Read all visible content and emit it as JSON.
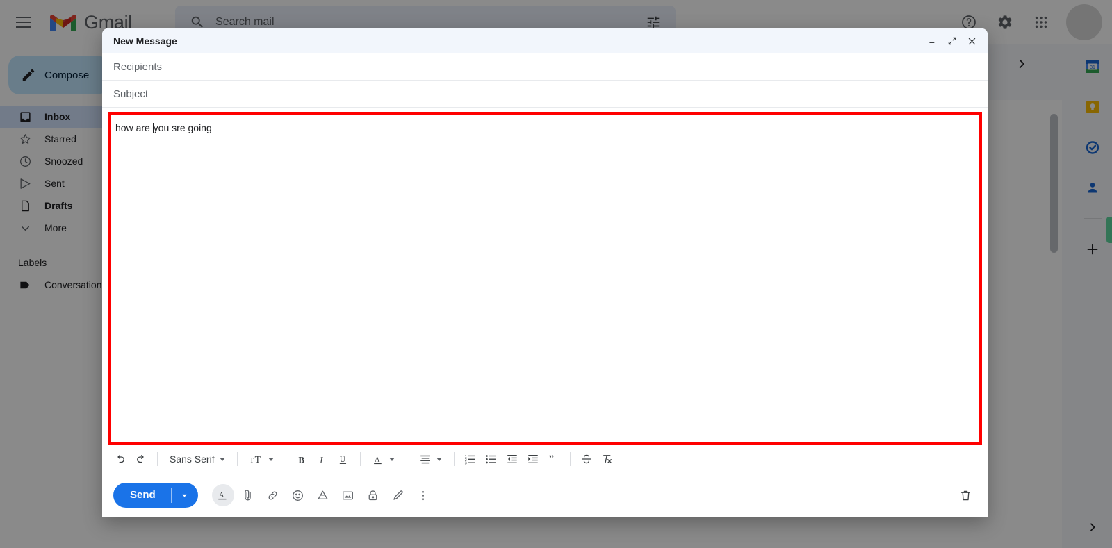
{
  "app": {
    "brand": "Gmail",
    "search": {
      "placeholder": "Search mail",
      "value": ""
    }
  },
  "topbar": {
    "menu_icon": "hamburger-icon",
    "search_icon": "search-icon",
    "tune_icon": "tune-filter-icon",
    "help_icon": "help-icon",
    "settings_icon": "gear-icon",
    "apps_icon": "apps-grid-icon",
    "avatar_icon": "avatar"
  },
  "sidebar": {
    "compose_label": "Compose",
    "items": [
      {
        "label": "Inbox",
        "icon": "inbox-icon",
        "active": true,
        "bold": true
      },
      {
        "label": "Starred",
        "icon": "star-icon",
        "active": false,
        "bold": false
      },
      {
        "label": "Snoozed",
        "icon": "clock-icon",
        "active": false,
        "bold": false
      },
      {
        "label": "Sent",
        "icon": "send-icon",
        "active": false,
        "bold": false
      },
      {
        "label": "Drafts",
        "icon": "document-icon",
        "active": false,
        "bold": true
      },
      {
        "label": "More",
        "icon": "chevron-down-icon",
        "active": false,
        "bold": false
      }
    ],
    "labels_heading": "Labels",
    "labels": [
      {
        "label": "Conversation",
        "icon": "label-tag-icon"
      }
    ]
  },
  "addons": {
    "items": [
      {
        "name": "google-calendar-icon",
        "title": "Calendar",
        "badge": "31"
      },
      {
        "name": "google-keep-icon",
        "title": "Keep"
      },
      {
        "name": "google-tasks-icon",
        "title": "Tasks"
      },
      {
        "name": "google-contacts-icon",
        "title": "Contacts"
      }
    ],
    "add_label": "+"
  },
  "compose": {
    "title": "New Message",
    "minimize_icon": "minimize-icon",
    "popout_icon": "popout-icon",
    "close_icon": "close-icon",
    "recipients_placeholder": "Recipients",
    "recipients_value": "",
    "subject_placeholder": "Subject",
    "subject_value": "",
    "body_text_before_caret": "how are ",
    "body_text_after_caret": "you sre going",
    "highlight_color": "#ff0000",
    "accent_color": "#1a73e8",
    "header_bg": "#f2f6fc",
    "format_toolbar": [
      {
        "name": "undo-icon",
        "label": ""
      },
      {
        "name": "redo-icon",
        "label": ""
      },
      {
        "name": "font-family-select",
        "label": "Sans Serif"
      },
      {
        "name": "font-size-select",
        "label": ""
      },
      {
        "name": "bold-icon",
        "label": "B"
      },
      {
        "name": "italic-icon",
        "label": "I"
      },
      {
        "name": "underline-icon",
        "label": "U"
      },
      {
        "name": "text-color-icon",
        "label": "A"
      },
      {
        "name": "align-icon",
        "label": ""
      },
      {
        "name": "numbered-list-icon",
        "label": ""
      },
      {
        "name": "bulleted-list-icon",
        "label": ""
      },
      {
        "name": "indent-less-icon",
        "label": ""
      },
      {
        "name": "indent-more-icon",
        "label": ""
      },
      {
        "name": "quote-icon",
        "label": ""
      },
      {
        "name": "strikethrough-icon",
        "label": ""
      },
      {
        "name": "remove-formatting-icon",
        "label": ""
      }
    ],
    "send_label": "Send",
    "send_dropdown_icon": "chevron-down-icon",
    "bottom_icons": [
      {
        "name": "formatting-options-icon",
        "active": true
      },
      {
        "name": "attach-file-icon",
        "active": false
      },
      {
        "name": "insert-link-icon",
        "active": false
      },
      {
        "name": "insert-emoji-icon",
        "active": false
      },
      {
        "name": "google-drive-icon",
        "active": false
      },
      {
        "name": "insert-photo-icon",
        "active": false
      },
      {
        "name": "confidential-mode-icon",
        "active": false
      },
      {
        "name": "insert-signature-icon",
        "active": false
      },
      {
        "name": "more-options-icon",
        "active": false
      }
    ],
    "discard_icon": "trash-icon"
  }
}
